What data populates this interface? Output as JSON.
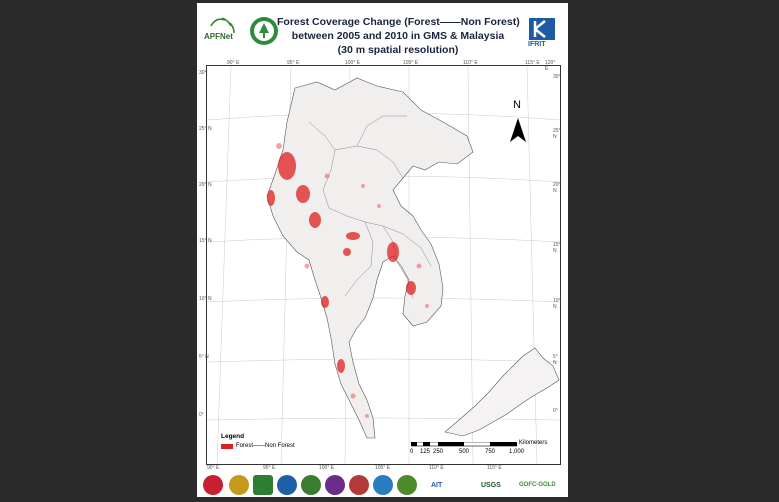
{
  "title": {
    "line1": "Forest Coverage Change (Forest——Non Forest)",
    "line2": "between 2005 and 2010 in GMS & Malaysia",
    "line3": "(30 m spatial resolution)"
  },
  "logos": {
    "apfnet": "APFNet",
    "ifrit": "IFRIT",
    "ait": "AIT",
    "usgs": "USGS",
    "gofc": "GOFC-GOLD"
  },
  "north_arrow": "N",
  "legend": {
    "title": "Legend",
    "item": "Forest——Non Forest",
    "swatch_color": "#e02020"
  },
  "scale": {
    "unit": "Kilometers",
    "labels": [
      "0",
      "125",
      "250",
      "500",
      "750",
      "1,000"
    ]
  },
  "graticule": {
    "top": [
      "90° E",
      "95° E",
      "100° E",
      "105° E",
      "110° E",
      "115° E",
      "120° E"
    ],
    "bottom": [
      "90° E",
      "95° E",
      "100° E",
      "105° E",
      "110° E",
      "115° E"
    ],
    "left": [
      "30°",
      "25° N",
      "20° N",
      "15° N",
      "10° N",
      "5° N",
      "0°"
    ],
    "right": [
      "30°",
      "25° N",
      "20° N",
      "15° N",
      "10° N",
      "5° N",
      "0°"
    ]
  }
}
